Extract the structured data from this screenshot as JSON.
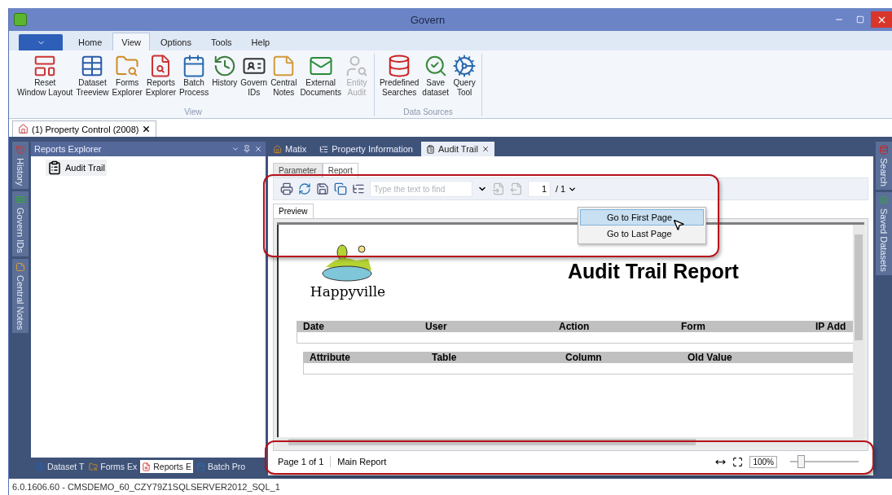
{
  "window": {
    "title": "Govern"
  },
  "ribbon_tabs": [
    {
      "label": "Home",
      "selected": false
    },
    {
      "label": "View",
      "selected": true
    },
    {
      "label": "Options",
      "selected": false
    },
    {
      "label": "Tools",
      "selected": false
    },
    {
      "label": "Help",
      "selected": false
    }
  ],
  "ribbon_groups": [
    {
      "label": "View",
      "buttons": [
        {
          "lines": [
            "Reset",
            "Window Layout"
          ],
          "disabled": false
        },
        {
          "lines": [
            "Dataset",
            "Treeview"
          ],
          "disabled": false
        },
        {
          "lines": [
            "Forms",
            "Explorer"
          ],
          "disabled": false
        },
        {
          "lines": [
            "Reports",
            "Explorer"
          ],
          "disabled": false
        },
        {
          "lines": [
            "Batch",
            "Process"
          ],
          "disabled": false
        },
        {
          "lines": [
            "History"
          ],
          "disabled": false
        },
        {
          "lines": [
            "Govern",
            "IDs"
          ],
          "disabled": false
        },
        {
          "lines": [
            "Central",
            "Notes"
          ],
          "disabled": false
        },
        {
          "lines": [
            "External",
            "Documents"
          ],
          "disabled": false
        },
        {
          "lines": [
            "Entity",
            "Audit"
          ],
          "disabled": true
        }
      ]
    },
    {
      "label": "Data Sources",
      "buttons": [
        {
          "lines": [
            "Predefined",
            "Searches"
          ],
          "disabled": false
        },
        {
          "lines": [
            "Save",
            "dataset"
          ],
          "disabled": false
        },
        {
          "lines": [
            "Query",
            "Tool"
          ],
          "disabled": false
        }
      ]
    }
  ],
  "document_tabs": [
    {
      "label": "(1) Property Control (2008)",
      "selected": true
    }
  ],
  "side_tabs_left": [
    {
      "label": "History"
    },
    {
      "label": "Govern IDs"
    },
    {
      "label": "Central Notes"
    }
  ],
  "side_tabs_right": [
    {
      "label": "Search"
    },
    {
      "label": "Saved Datasets"
    }
  ],
  "explorer": {
    "title": "Reports Explorer",
    "items": [
      {
        "label": "Audit Trail"
      }
    ],
    "bottom_tabs": [
      {
        "label": "Dataset T",
        "selected": false
      },
      {
        "label": "Forms Ex",
        "selected": false
      },
      {
        "label": "Reports E",
        "selected": true
      },
      {
        "label": "Batch Pro",
        "selected": false
      }
    ]
  },
  "content_tabs": [
    {
      "label": "Matix",
      "selected": false
    },
    {
      "label": "Property Information",
      "selected": false
    },
    {
      "label": "Audit Trail",
      "selected": true
    }
  ],
  "report_tabs": [
    {
      "label": "Parameter",
      "selected": false
    },
    {
      "label": "Report",
      "selected": true
    }
  ],
  "toolbar": {
    "search_placeholder": "Type the text to find",
    "page": "1",
    "page_total": "/ 1"
  },
  "page_menu": [
    {
      "label": "Go to First Page",
      "selected": true
    },
    {
      "label": "Go to Last Page",
      "selected": false
    }
  ],
  "preview_tab": "Preview",
  "report": {
    "logo_text": "Happyville",
    "title": "Audit Trail Report",
    "columns": [
      "Date",
      "User",
      "Action",
      "Form",
      "IP Add"
    ],
    "detail_columns": [
      "Attribute",
      "Table",
      "Column",
      "Old Value"
    ]
  },
  "preview_status": {
    "page": "Page 1 of 1",
    "section": "Main Report",
    "zoom": "100%",
    "zoom_level": {
      "level": 0.15
    }
  },
  "status_bar": "6.0.1606.60 - CMSDEMO_60_CZY79Z1SQLSERVER2012_SQL_1"
}
